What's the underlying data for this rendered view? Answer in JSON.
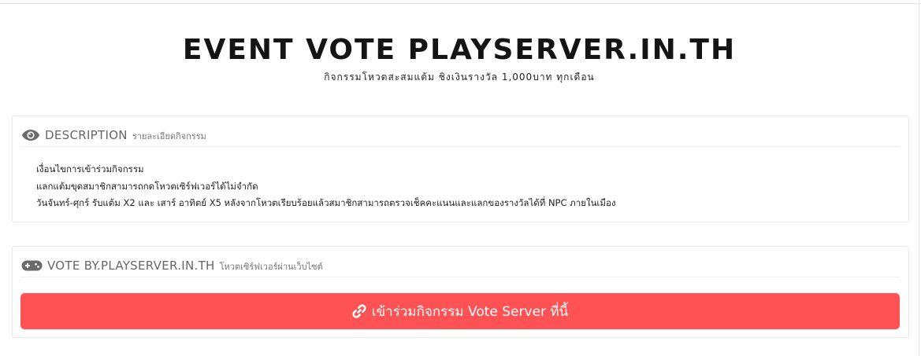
{
  "header": {
    "title": "EVENT VOTE PLAYSERVER.IN.TH",
    "subtitle": "กิจกรรมโหวตสะสมแต้ม ชิงเงินรางวัล 1,000บาท ทุกเดือน"
  },
  "description_panel": {
    "icon": "eye-icon",
    "title": "DESCRIPTION",
    "subtitle": "รายละเอียดกิจกรรม",
    "lines": [
      "เงื่อนไขการเข้าร่วมกิจกรรม",
      "แลกแต้มขุดสมาชิกสามารถกดโหวตเซิร์ฟเวอร์ได้ไม่จำกัด",
      "วันจันทร์-ศุกร์ รับแต้ม X2 และ เสาร์ อาทิตย์ X5 หลังจากโหวตเรียบร้อยแล้วสมาชิกสามารถตรวจเช็คคะแนนและแลกของรางวัลได้ที่ NPC ภายในเมือง"
    ]
  },
  "vote_panel": {
    "icon": "gamepad-icon",
    "title": "VOTE BY.PLAYSERVER.IN.TH",
    "subtitle": "โหวตเซิร์ฟเวอร์ผ่านเว็บไซต์",
    "button": {
      "icon": "link-icon",
      "label": "เข้าร่วมกิจกรรม Vote Server ที่นี้",
      "color": "#fe5254"
    }
  }
}
